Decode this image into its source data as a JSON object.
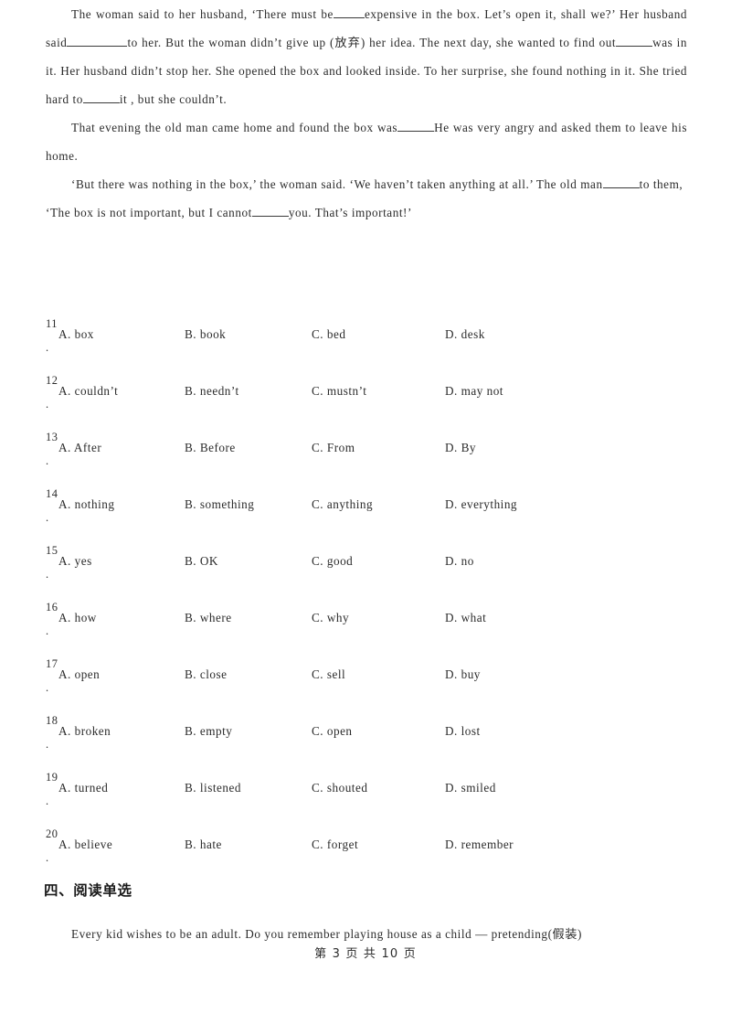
{
  "passage": {
    "paragraphs": [
      {
        "segments": [
          {
            "type": "text",
            "value": "The woman said to her husband,  ‘There must be"
          },
          {
            "type": "blank",
            "size": "short"
          },
          {
            "type": "text",
            "value": "expensive in the box. Let’s open it, shall we?’  Her husband said"
          },
          {
            "type": "blank",
            "size": "long"
          },
          {
            "type": "text",
            "value": "to her. But the woman didn’t give up (放弃) her idea. The next day, she wanted to find out"
          },
          {
            "type": "blank",
            "size": "mid"
          },
          {
            "type": "text",
            "value": "was in it. Her husband didn’t stop her. She opened the box and looked inside. To her surprise, she found nothing in it. She tried hard to"
          },
          {
            "type": "blank",
            "size": "mid"
          },
          {
            "type": "text",
            "value": "it , but she couldn’t."
          }
        ]
      },
      {
        "segments": [
          {
            "type": "text",
            "value": "That evening the old man came home and found the box was"
          },
          {
            "type": "blank",
            "size": "mid"
          },
          {
            "type": "text",
            "value": "He was very angry and asked them to leave his home."
          }
        ]
      },
      {
        "segments": [
          {
            "type": "text",
            "value": "‘But there was nothing in the box,’  the woman said.  ‘We haven’t taken anything at all.’ The old man"
          },
          {
            "type": "blank",
            "size": "mid"
          },
          {
            "type": "text",
            "value": "to them,  ‘The box is not important, but I cannot"
          },
          {
            "type": "blank",
            "size": "mid"
          },
          {
            "type": "text",
            "value": "you. That’s important!’"
          }
        ]
      }
    ]
  },
  "questions": [
    {
      "number": "11",
      "dot": ".",
      "options": [
        "A. box",
        "B. book",
        "C. bed",
        "D. desk"
      ]
    },
    {
      "number": "12",
      "dot": ".",
      "options": [
        "A. couldn’t",
        "B. needn’t",
        "C. mustn’t",
        "D. may not"
      ]
    },
    {
      "number": "13",
      "dot": ".",
      "options": [
        "A. After",
        "B. Before",
        "C. From",
        "D. By"
      ]
    },
    {
      "number": "14",
      "dot": ".",
      "options": [
        "A. nothing",
        "B. something",
        "C. anything",
        "D. everything"
      ]
    },
    {
      "number": "15",
      "dot": ".",
      "options": [
        "A. yes",
        "B. OK",
        "C. good",
        "D. no"
      ]
    },
    {
      "number": "16",
      "dot": ".",
      "options": [
        "A. how",
        "B. where",
        "C. why",
        "D. what"
      ]
    },
    {
      "number": "17",
      "dot": ".",
      "options": [
        "A. open",
        "B. close",
        "C. sell",
        "D. buy"
      ]
    },
    {
      "number": "18",
      "dot": ".",
      "options": [
        "A. broken",
        "B. empty",
        "C. open",
        "D. lost"
      ]
    },
    {
      "number": "19",
      "dot": ".",
      "options": [
        "A. turned",
        "B. listened",
        "C. shouted",
        "D. smiled"
      ]
    },
    {
      "number": "20",
      "dot": ".",
      "options": [
        "A. believe",
        "B. hate",
        "C. forget",
        "D. remember"
      ]
    }
  ],
  "section": {
    "heading": "四、阅读单选"
  },
  "reading": {
    "intro": "Every kid wishes to be an adult. Do you remember playing house as a child — pretending(假装)"
  },
  "footer": {
    "text": "第 3 页 共 10 页"
  },
  "colors": {
    "page_background": "#ffffff",
    "body_text": "#2b2b2b",
    "heading_text": "#1a1a1a",
    "blank_rule": "#3a3a3a"
  }
}
